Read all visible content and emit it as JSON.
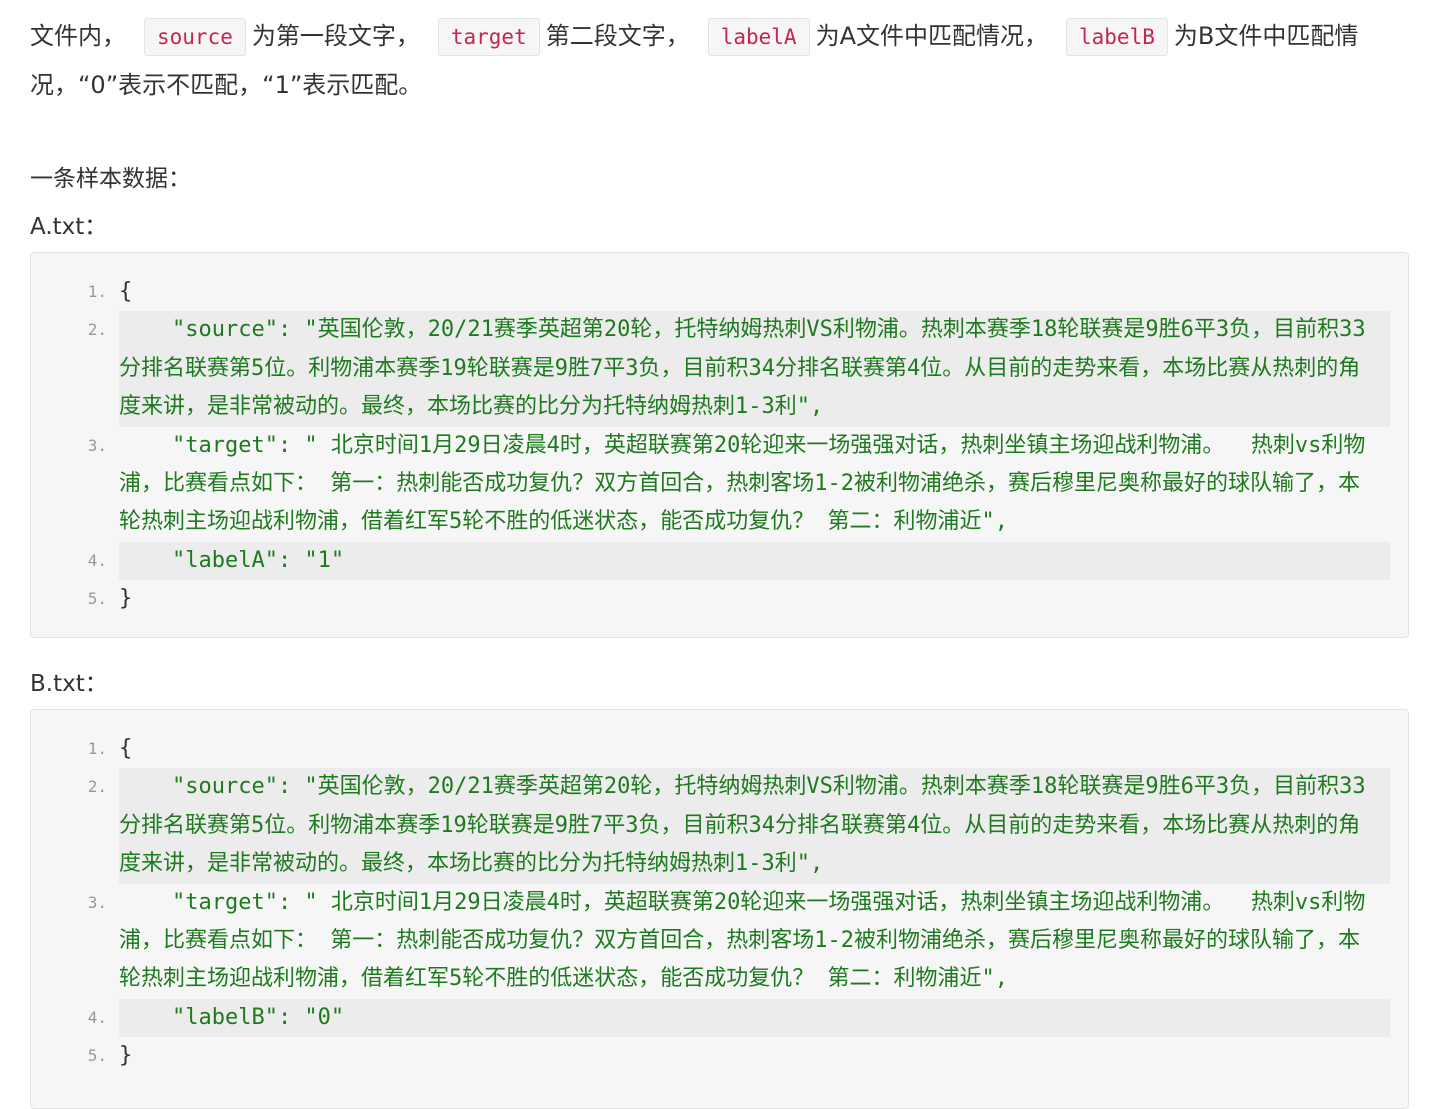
{
  "intro": {
    "text1": "文件内，",
    "code_source": "source",
    "text2": "为第一段文字，",
    "code_target": "target",
    "text3": "第二段文字，",
    "code_labelA": "labelA",
    "text4": "为A文件中匹配情况，",
    "code_labelB": "labelB",
    "text5": "为B文件中匹配情况，“0”表示不匹配，“1”表示匹配。"
  },
  "sample_heading": "一条样本数据：",
  "fileA": {
    "name": "A.txt：",
    "lines": [
      {
        "num": "1.",
        "text": "{"
      },
      {
        "num": "2.",
        "text": "\"source\": \"英国伦敦，20/21赛季英超第20轮，托特纳姆热刺VS利物浦。热刺本赛季18轮联赛是9胜6平3负，目前积33分排名联赛第5位。利物浦本赛季19轮联赛是9胜7平3负，目前积34分排名联赛第4位。从目前的走势来看，本场比赛从热刺的角度来讲，是非常被动的。最终，本场比赛的比分为托特纳姆热刺1-3利\","
      },
      {
        "num": "3.",
        "text": "\"target\": \" 北京时间1月29日凌晨4时，英超联赛第20轮迎来一场强强对话，热刺坐镇主场迎战利物浦。  热刺vs利物浦，比赛看点如下： 第一：热刺能否成功复仇？双方首回合，热刺客场1-2被利物浦绝杀，赛后穆里尼奥称最好的球队输了，本轮热刺主场迎战利物浦，借着红军5轮不胜的低迷状态，能否成功复仇？ 第二：利物浦近\","
      },
      {
        "num": "4.",
        "text": "\"labelA\": \"1\""
      },
      {
        "num": "5.",
        "text": "}"
      }
    ]
  },
  "fileB": {
    "name": "B.txt：",
    "lines": [
      {
        "num": "1.",
        "text": "{"
      },
      {
        "num": "2.",
        "text": "\"source\": \"英国伦敦，20/21赛季英超第20轮，托特纳姆热刺VS利物浦。热刺本赛季18轮联赛是9胜6平3负，目前积33分排名联赛第5位。利物浦本赛季19轮联赛是9胜7平3负，目前积34分排名联赛第4位。从目前的走势来看，本场比赛从热刺的角度来讲，是非常被动的。最终，本场比赛的比分为托特纳姆热刺1-3利\","
      },
      {
        "num": "3.",
        "text": "\"target\": \" 北京时间1月29日凌晨4时，英超联赛第20轮迎来一场强强对话，热刺坐镇主场迎战利物浦。  热刺vs利物浦，比赛看点如下： 第一：热刺能否成功复仇？双方首回合，热刺客场1-2被利物浦绝杀，赛后穆里尼奥称最好的球队输了，本轮热刺主场迎战利物浦，借着红军5轮不胜的低迷状态，能否成功复仇？ 第二：利物浦近\","
      },
      {
        "num": "4.",
        "text": "\"labelB\": \"0\""
      },
      {
        "num": "5.",
        "text": "}"
      }
    ]
  }
}
